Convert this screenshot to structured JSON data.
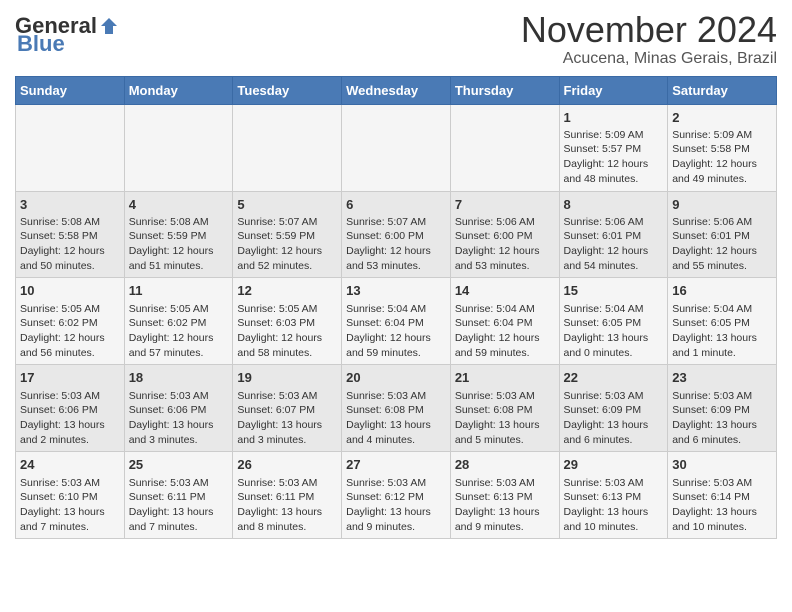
{
  "header": {
    "logo_general": "General",
    "logo_blue": "Blue",
    "month": "November 2024",
    "location": "Acucena, Minas Gerais, Brazil"
  },
  "days_of_week": [
    "Sunday",
    "Monday",
    "Tuesday",
    "Wednesday",
    "Thursday",
    "Friday",
    "Saturday"
  ],
  "weeks": [
    [
      {
        "day": "",
        "content": ""
      },
      {
        "day": "",
        "content": ""
      },
      {
        "day": "",
        "content": ""
      },
      {
        "day": "",
        "content": ""
      },
      {
        "day": "",
        "content": ""
      },
      {
        "day": "1",
        "content": "Sunrise: 5:09 AM\nSunset: 5:57 PM\nDaylight: 12 hours and 48 minutes."
      },
      {
        "day": "2",
        "content": "Sunrise: 5:09 AM\nSunset: 5:58 PM\nDaylight: 12 hours and 49 minutes."
      }
    ],
    [
      {
        "day": "3",
        "content": "Sunrise: 5:08 AM\nSunset: 5:58 PM\nDaylight: 12 hours and 50 minutes."
      },
      {
        "day": "4",
        "content": "Sunrise: 5:08 AM\nSunset: 5:59 PM\nDaylight: 12 hours and 51 minutes."
      },
      {
        "day": "5",
        "content": "Sunrise: 5:07 AM\nSunset: 5:59 PM\nDaylight: 12 hours and 52 minutes."
      },
      {
        "day": "6",
        "content": "Sunrise: 5:07 AM\nSunset: 6:00 PM\nDaylight: 12 hours and 53 minutes."
      },
      {
        "day": "7",
        "content": "Sunrise: 5:06 AM\nSunset: 6:00 PM\nDaylight: 12 hours and 53 minutes."
      },
      {
        "day": "8",
        "content": "Sunrise: 5:06 AM\nSunset: 6:01 PM\nDaylight: 12 hours and 54 minutes."
      },
      {
        "day": "9",
        "content": "Sunrise: 5:06 AM\nSunset: 6:01 PM\nDaylight: 12 hours and 55 minutes."
      }
    ],
    [
      {
        "day": "10",
        "content": "Sunrise: 5:05 AM\nSunset: 6:02 PM\nDaylight: 12 hours and 56 minutes."
      },
      {
        "day": "11",
        "content": "Sunrise: 5:05 AM\nSunset: 6:02 PM\nDaylight: 12 hours and 57 minutes."
      },
      {
        "day": "12",
        "content": "Sunrise: 5:05 AM\nSunset: 6:03 PM\nDaylight: 12 hours and 58 minutes."
      },
      {
        "day": "13",
        "content": "Sunrise: 5:04 AM\nSunset: 6:04 PM\nDaylight: 12 hours and 59 minutes."
      },
      {
        "day": "14",
        "content": "Sunrise: 5:04 AM\nSunset: 6:04 PM\nDaylight: 12 hours and 59 minutes."
      },
      {
        "day": "15",
        "content": "Sunrise: 5:04 AM\nSunset: 6:05 PM\nDaylight: 13 hours and 0 minutes."
      },
      {
        "day": "16",
        "content": "Sunrise: 5:04 AM\nSunset: 6:05 PM\nDaylight: 13 hours and 1 minute."
      }
    ],
    [
      {
        "day": "17",
        "content": "Sunrise: 5:03 AM\nSunset: 6:06 PM\nDaylight: 13 hours and 2 minutes."
      },
      {
        "day": "18",
        "content": "Sunrise: 5:03 AM\nSunset: 6:06 PM\nDaylight: 13 hours and 3 minutes."
      },
      {
        "day": "19",
        "content": "Sunrise: 5:03 AM\nSunset: 6:07 PM\nDaylight: 13 hours and 3 minutes."
      },
      {
        "day": "20",
        "content": "Sunrise: 5:03 AM\nSunset: 6:08 PM\nDaylight: 13 hours and 4 minutes."
      },
      {
        "day": "21",
        "content": "Sunrise: 5:03 AM\nSunset: 6:08 PM\nDaylight: 13 hours and 5 minutes."
      },
      {
        "day": "22",
        "content": "Sunrise: 5:03 AM\nSunset: 6:09 PM\nDaylight: 13 hours and 6 minutes."
      },
      {
        "day": "23",
        "content": "Sunrise: 5:03 AM\nSunset: 6:09 PM\nDaylight: 13 hours and 6 minutes."
      }
    ],
    [
      {
        "day": "24",
        "content": "Sunrise: 5:03 AM\nSunset: 6:10 PM\nDaylight: 13 hours and 7 minutes."
      },
      {
        "day": "25",
        "content": "Sunrise: 5:03 AM\nSunset: 6:11 PM\nDaylight: 13 hours and 7 minutes."
      },
      {
        "day": "26",
        "content": "Sunrise: 5:03 AM\nSunset: 6:11 PM\nDaylight: 13 hours and 8 minutes."
      },
      {
        "day": "27",
        "content": "Sunrise: 5:03 AM\nSunset: 6:12 PM\nDaylight: 13 hours and 9 minutes."
      },
      {
        "day": "28",
        "content": "Sunrise: 5:03 AM\nSunset: 6:13 PM\nDaylight: 13 hours and 9 minutes."
      },
      {
        "day": "29",
        "content": "Sunrise: 5:03 AM\nSunset: 6:13 PM\nDaylight: 13 hours and 10 minutes."
      },
      {
        "day": "30",
        "content": "Sunrise: 5:03 AM\nSunset: 6:14 PM\nDaylight: 13 hours and 10 minutes."
      }
    ]
  ]
}
